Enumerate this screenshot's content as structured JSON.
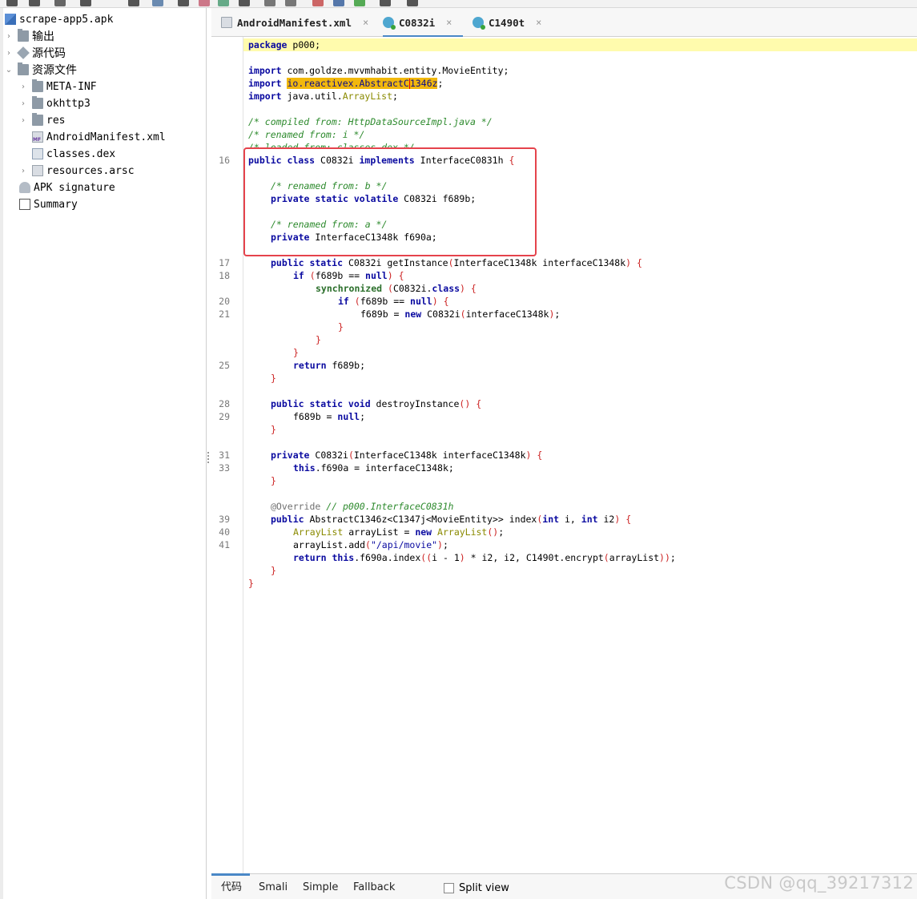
{
  "tree": {
    "items": [
      {
        "label": "scrape-app5.apk",
        "icon": "apk-icon",
        "level": 0,
        "chevron": ""
      },
      {
        "label": "输出",
        "icon": "output-folder-icon",
        "level": 1,
        "chevron": "›"
      },
      {
        "label": "源代码",
        "icon": "package-icon",
        "level": 1,
        "chevron": "›"
      },
      {
        "label": "资源文件",
        "icon": "resources-folder-icon",
        "level": 1,
        "chevron": "⌄"
      },
      {
        "label": "META-INF",
        "icon": "folder-icon",
        "level": 2,
        "chevron": "›"
      },
      {
        "label": "okhttp3",
        "icon": "folder-icon",
        "level": 2,
        "chevron": "›"
      },
      {
        "label": "res",
        "icon": "folder-icon",
        "level": 2,
        "chevron": "›"
      },
      {
        "label": "AndroidManifest.xml",
        "icon": "manifest-file-icon",
        "level": 2,
        "chevron": ""
      },
      {
        "label": "classes.dex",
        "icon": "dex-file-icon",
        "level": 2,
        "chevron": ""
      },
      {
        "label": "resources.arsc",
        "icon": "arsc-file-icon",
        "level": 2,
        "chevron": "›"
      },
      {
        "label": "APK signature",
        "icon": "signature-icon",
        "level": 1,
        "chevron": ""
      },
      {
        "label": "Summary",
        "icon": "summary-icon",
        "level": 1,
        "chevron": ""
      }
    ]
  },
  "tabs": [
    {
      "label": "AndroidManifest.xml",
      "icon": "manifest-file-icon",
      "close": "×",
      "active": false
    },
    {
      "label": "C0832i",
      "icon": "class-icon",
      "close": "×",
      "active": true
    },
    {
      "label": "C1490t",
      "icon": "class-icon",
      "close": "×",
      "active": false
    }
  ],
  "editor": {
    "line_numbers": [
      "16",
      "17",
      "18",
      "20",
      "21",
      "25",
      "28",
      "29",
      "31",
      "33",
      "39",
      "40",
      "41"
    ],
    "code": {
      "package_kw": "package",
      "package_name": " p000;",
      "import_kw": "import",
      "import1": " com.goldze.mvvmhabit.entity.MovieEntity;",
      "import2_a": "io.reactivex.AbstractC",
      "import2_b": "1346z",
      "import2_end": ";",
      "import3_a": " java.util.",
      "import3_b": "ArrayList",
      "import3_c": ";",
      "comment1": "/* compiled from: HttpDataSourceImpl.java */",
      "comment2": "/* renamed from: i */",
      "comment3": "/* loaded from: classes.dex */",
      "class_decl_kw": "public class",
      "class_name": " C0832i ",
      "implements_kw": "implements",
      "iface": " InterfaceC0831h ",
      "brace_open": "{",
      "brace_close": "}",
      "renamed_b": "/* renamed from: b */",
      "field1_kw": "private static volatile",
      "field1_rest": " C0832i f689b;",
      "renamed_a": "/* renamed from: a */",
      "field2_kw": "private",
      "field2_rest": " InterfaceC1348k f690a;",
      "getinst_kw": "public static",
      "getinst_rest": " C0832i getInstance",
      "getinst_params": "InterfaceC1348k interfaceC1348k",
      "if_kw": "if",
      "null_kw": "null",
      "cond_var": "f689b == ",
      "sync_kw": "synchronized",
      "sync_arg": "C0832i.",
      "class_kw": "class",
      "assign1": "f689b = ",
      "new_kw": "new",
      "new_call": " C0832i",
      "new_arg": "interfaceC1348k",
      "return_kw": "return",
      "return1": " f689b;",
      "destroy_kw": "public static void",
      "destroy_rest": " destroyInstance",
      "assign_null": "f689b = ",
      "ctor_kw": "private",
      "ctor_rest": " C0832i",
      "ctor_params": "InterfaceC1348k interfaceC1348k",
      "this_kw": "this",
      "ctor_body": ".f690a = interfaceC1348k;",
      "override_anno": "@Override",
      "override_comment": " // p000.InterfaceC0831h",
      "index_kw": "public",
      "index_rest": " AbstractC1346z<C1347j<MovieEntity>> index",
      "int_kw": "int",
      "index_p1": " i, ",
      "index_p2": " i2",
      "arraylist_type": "ArrayList",
      "arraylist_var": " arrayList = ",
      "arraylist_add": "arrayList.add",
      "api_str": "\"/api/movie\"",
      "index_call": ".f690a.index",
      "index_args_a": "i - 1",
      "index_args_b": " * i2, i2, C1490t.encrypt",
      "index_args_c": "arrayList"
    }
  },
  "bottom_tabs": [
    {
      "label": "代码",
      "active": true
    },
    {
      "label": "Smali",
      "active": false
    },
    {
      "label": "Simple",
      "active": false
    },
    {
      "label": "Fallback",
      "active": false
    }
  ],
  "split_view": {
    "label": "Split view",
    "checked": false
  },
  "watermark": "CSDN @qq_39217312",
  "colors": {
    "keyword": "#0a0aa0",
    "comment": "#2d8a2d",
    "highlight": "#f2b80c",
    "annotation_box": "#e5434c",
    "active_tab": "#4a88c7"
  }
}
